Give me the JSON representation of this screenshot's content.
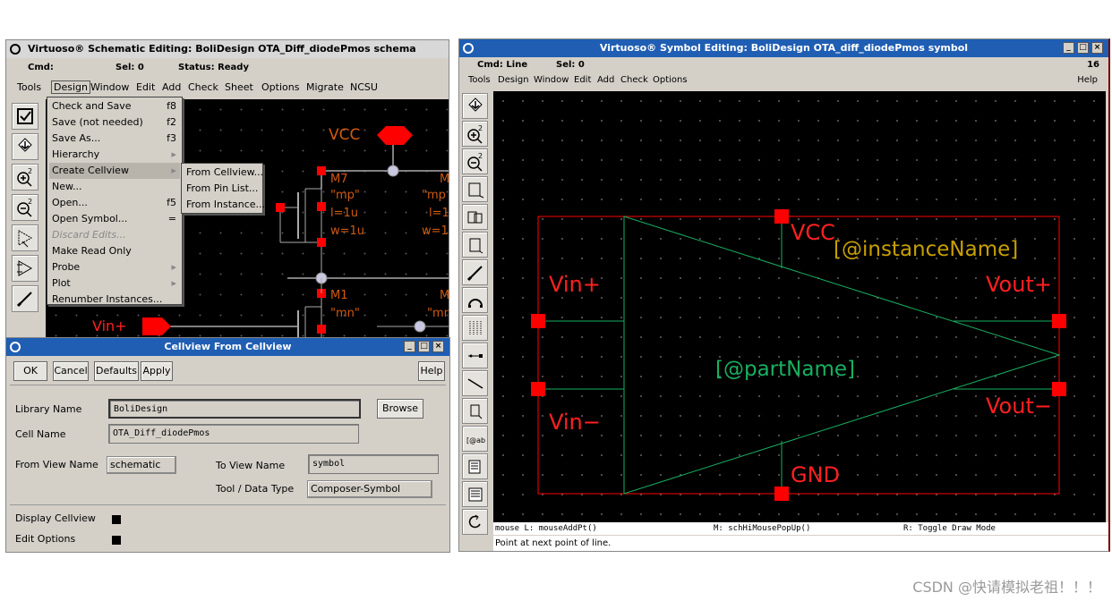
{
  "schematic_window": {
    "title": "Virtuoso® Schematic Editing: BoliDesign OTA_Diff_diodePmos schema",
    "status": {
      "cmd": "Cmd:",
      "sel": "Sel: 0",
      "state": "Status: Ready"
    },
    "menu": [
      "Tools",
      "Design",
      "Window",
      "Edit",
      "Add",
      "Check",
      "Sheet",
      "Options",
      "Migrate",
      "NCSU"
    ],
    "design_menu": [
      {
        "label": "Check and Save",
        "accel": "f8"
      },
      {
        "label": "Save (not needed)",
        "accel": "f2"
      },
      {
        "label": "Save As...",
        "accel": "f3"
      },
      {
        "label": "Hierarchy",
        "accel": ""
      },
      {
        "label": "Create Cellview",
        "accel": ""
      },
      {
        "label": "New...",
        "accel": ""
      },
      {
        "label": "Open...",
        "accel": "f5"
      },
      {
        "label": "Open Symbol...",
        "accel": "="
      },
      {
        "label": "Discard Edits...",
        "accel": ""
      },
      {
        "label": "Make Read Only",
        "accel": ""
      },
      {
        "label": "Probe",
        "accel": ""
      },
      {
        "label": "Plot",
        "accel": ""
      },
      {
        "label": "Renumber Instances...",
        "accel": ""
      }
    ],
    "create_cellview_submenu": [
      "From Cellview...",
      "From Pin List...",
      "From Instance..."
    ],
    "canvas": {
      "vcc": "VCC",
      "m7": "M7",
      "m7_model": "\"mp\"",
      "m7_l": "l=1u",
      "m7_w": "w=1u",
      "m7b": "M",
      "m7b_model": "\"mp",
      "m7b_l": "l=1",
      "m7b_w": "w=1",
      "m1": "M1",
      "m1_model": "\"mn\"",
      "m1b": "M",
      "m1b_model": "\"mn",
      "vin_plus": "Vin+"
    }
  },
  "dialog": {
    "title": "Cellview From Cellview",
    "buttons": {
      "ok": "OK",
      "cancel": "Cancel",
      "defaults": "Defaults",
      "apply": "Apply",
      "help": "Help"
    },
    "library_label": "Library Name",
    "library_value": "BoliDesign",
    "browse": "Browse",
    "cell_label": "Cell Name",
    "cell_value": "OTA_Diff_diodePmos",
    "from_view_label": "From View Name",
    "from_view_value": "schematic",
    "to_view_label": "To View Name",
    "to_view_value": "symbol",
    "tool_label": "Tool / Data Type",
    "tool_value": "Composer-Symbol",
    "display_label": "Display Cellview",
    "edit_label": "Edit Options"
  },
  "symbol_window": {
    "title": "Virtuoso® Symbol Editing: BoliDesign OTA_diff_diodePmos symbol",
    "status": {
      "cmd": "Cmd: Line",
      "sel": "Sel: 0",
      "num": "16"
    },
    "menu": [
      "Tools",
      "Design",
      "Window",
      "Edit",
      "Add",
      "Check",
      "Options"
    ],
    "help": "Help",
    "canvas": {
      "vcc": "VCC",
      "gnd": "GND",
      "vin_plus": "Vin+",
      "vin_minus": "Vin−",
      "vout_plus": "Vout+",
      "vout_minus": "Vout−",
      "instance_name": "[@instanceName]",
      "part_name": "[@partName]"
    },
    "mouse_l": "mouse L: mouseAddPt()",
    "mouse_m": "M: schHiMousePopUp()",
    "mouse_r": "R: Toggle Draw Mode",
    "prompt": "Point at next point of line."
  },
  "watermark": "CSDN @快请模拟老祖！！！",
  "colors": {
    "red": "#ff0000",
    "orange": "#d05a10",
    "green": "#18b060",
    "yellow": "#c8a000",
    "titlebar_active": "#1f5eb3"
  }
}
